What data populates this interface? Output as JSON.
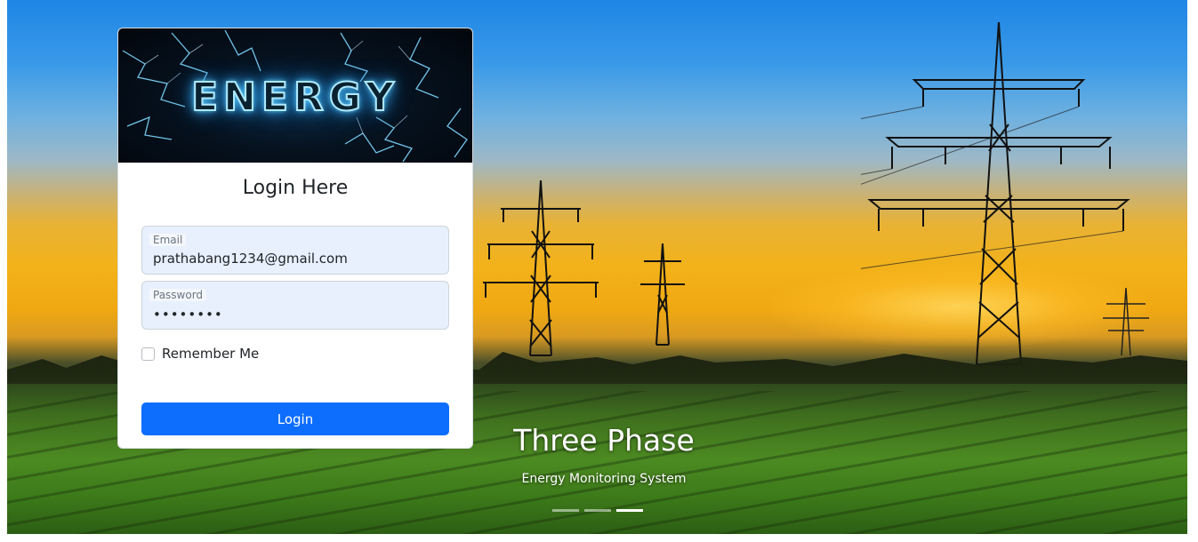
{
  "banner": {
    "logo_text": "ENERGY"
  },
  "login": {
    "title": "Login Here",
    "email": {
      "label": "Email",
      "value": "prathabang1234@gmail.com"
    },
    "password": {
      "label": "Password",
      "masked_value": "••••••••"
    },
    "remember_label": "Remember Me",
    "submit_label": "Login"
  },
  "carousel": {
    "title": "Three Phase",
    "subtitle": "Energy Monitoring System",
    "slide_count": 3,
    "active_slide": 3
  },
  "colors": {
    "primary": "#0d6efd",
    "input_bg": "#e8f0fe",
    "text": "#212529"
  }
}
